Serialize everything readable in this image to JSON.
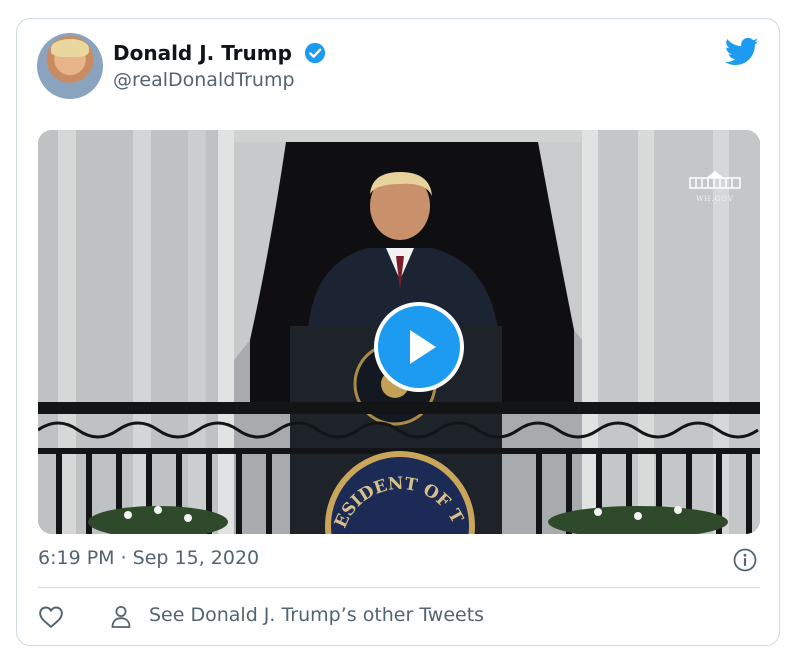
{
  "tweet": {
    "author_name": "Donald J. Trump",
    "handle": "@realDonaldTrump",
    "timestamp": "6:19 PM · Sep 15, 2020",
    "other_tweets_label": "See Donald J. Trump’s other Tweets"
  },
  "media": {
    "seal_text": "ESIDENT OF THE UN",
    "watermark": "WH.GOV"
  },
  "colors": {
    "accent": "#1d9bf0",
    "text_primary": "#0f1419",
    "text_secondary": "#536471",
    "border": "#cfd9de"
  },
  "icons": [
    "verified-badge-icon",
    "twitter-bird-icon",
    "play-icon",
    "info-icon",
    "heart-icon",
    "person-icon"
  ]
}
